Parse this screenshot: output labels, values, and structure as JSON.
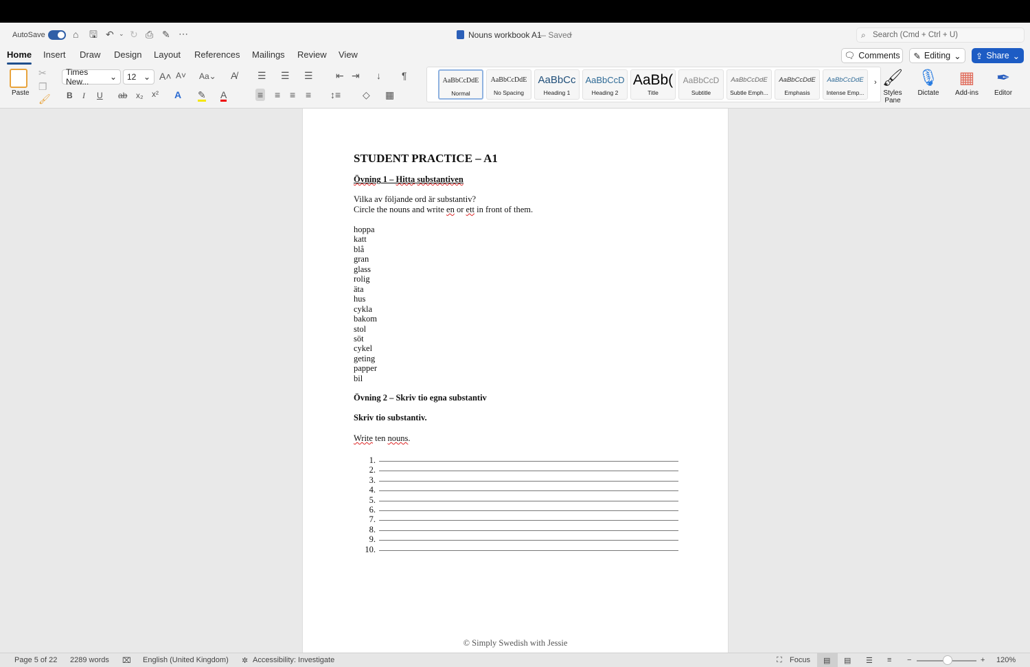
{
  "titlebar": {
    "autosave": "AutoSave",
    "doc_title": "Nouns workbook A1",
    "saved": "— Saved",
    "search_placeholder": "Search (Cmd + Ctrl + U)"
  },
  "tabs": [
    "Home",
    "Insert",
    "Draw",
    "Design",
    "Layout",
    "References",
    "Mailings",
    "Review",
    "View"
  ],
  "actions": {
    "comments": "Comments",
    "editing": "Editing",
    "share": "Share"
  },
  "ribbon": {
    "paste": "Paste",
    "font": "Times New...",
    "size": "12",
    "styles_pane": "Styles Pane",
    "dictate": "Dictate",
    "addins": "Add-ins",
    "editor": "Editor"
  },
  "styles": [
    {
      "sample": "AaBbCcDdE",
      "label": "Normal"
    },
    {
      "sample": "AaBbCcDdE",
      "label": "No Spacing"
    },
    {
      "sample": "AaBbCc",
      "label": "Heading 1"
    },
    {
      "sample": "AaBbCcD",
      "label": "Heading 2"
    },
    {
      "sample": "AaBb(",
      "label": "Title"
    },
    {
      "sample": "AaBbCcD",
      "label": "Subtitle"
    },
    {
      "sample": "AaBbCcDdE",
      "label": "Subtle Emph..."
    },
    {
      "sample": "AaBbCcDdE",
      "label": "Emphasis"
    },
    {
      "sample": "AaBbCcDdE",
      "label": "Intense Emp..."
    }
  ],
  "doc": {
    "title": "STUDENT PRACTICE – A1",
    "ex1_a": "Övning",
    "ex1_b": " 1 – ",
    "ex1_c": "Hitta",
    "ex1_d": " ",
    "ex1_e": "substantiven",
    "q_sv": "Vilka av följande ord är substantiv?",
    "q_en_a": "Circle the nouns and write ",
    "q_en_en": "en",
    "q_en_or": " or ",
    "q_en_ett": "ett",
    "q_en_b": " in front of them.",
    "words": [
      "hoppa",
      "katt",
      "blå",
      "gran",
      "glass",
      "rolig",
      "äta",
      "hus",
      "cykla",
      "bakom",
      "stol",
      "söt",
      "cykel",
      "geting",
      "papper",
      "bil"
    ],
    "ex2": "Övning 2 – Skriv tio egna substantiv",
    "ex2_sub": "Skriv tio substantiv.",
    "write_a": "Write",
    "write_b": " ten ",
    "write_c": "nouns",
    ".": ".",
    "numbers": [
      "1.",
      "2.",
      "3.",
      "4.",
      "5.",
      "6.",
      "7.",
      "8.",
      "9.",
      "10."
    ],
    "footer": "© Simply Swedish with Jessie"
  },
  "status": {
    "page": "Page 5 of 22",
    "words": "2289 words",
    "language": "English (United Kingdom)",
    "accessibility": "Accessibility: Investigate",
    "focus": "Focus",
    "zoom": "120%"
  }
}
